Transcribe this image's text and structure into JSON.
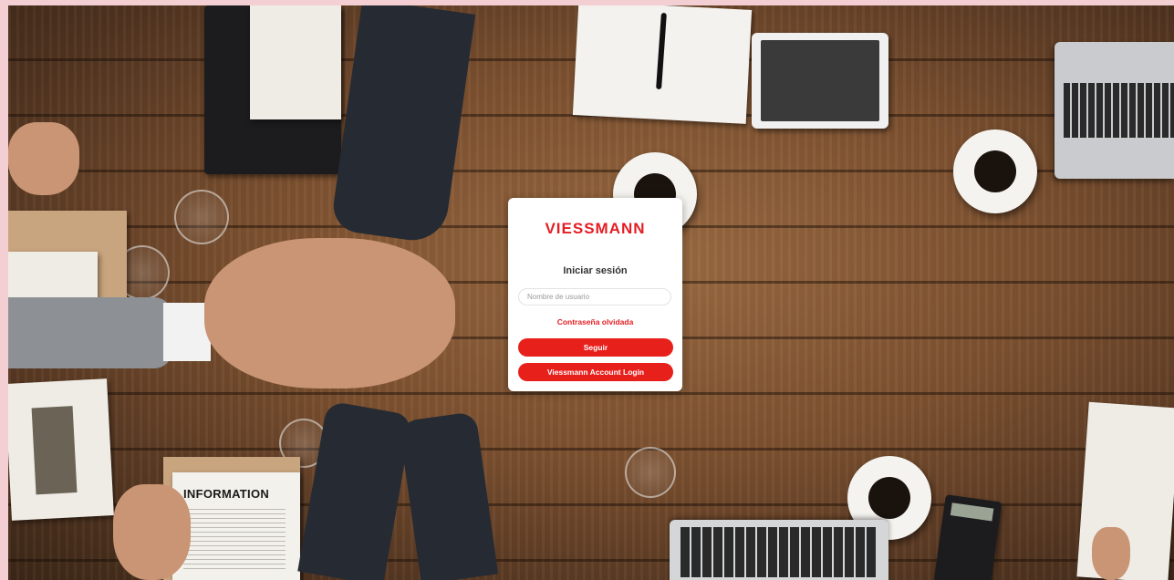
{
  "background": {
    "description_icon": "team-handshake-photo",
    "document_heading": "INFORMATION"
  },
  "login": {
    "logo_text": "VIESSMANN",
    "title": "Iniciar sesión",
    "username_placeholder": "Nombre de usuario",
    "username_value": "",
    "forgot_password": "Contraseña olvidada",
    "continue_button": "Seguir",
    "account_login_button": "Viessmann Account Login"
  },
  "colors": {
    "brand_red": "#e31e24",
    "frame_pink": "#f3cfd3"
  }
}
